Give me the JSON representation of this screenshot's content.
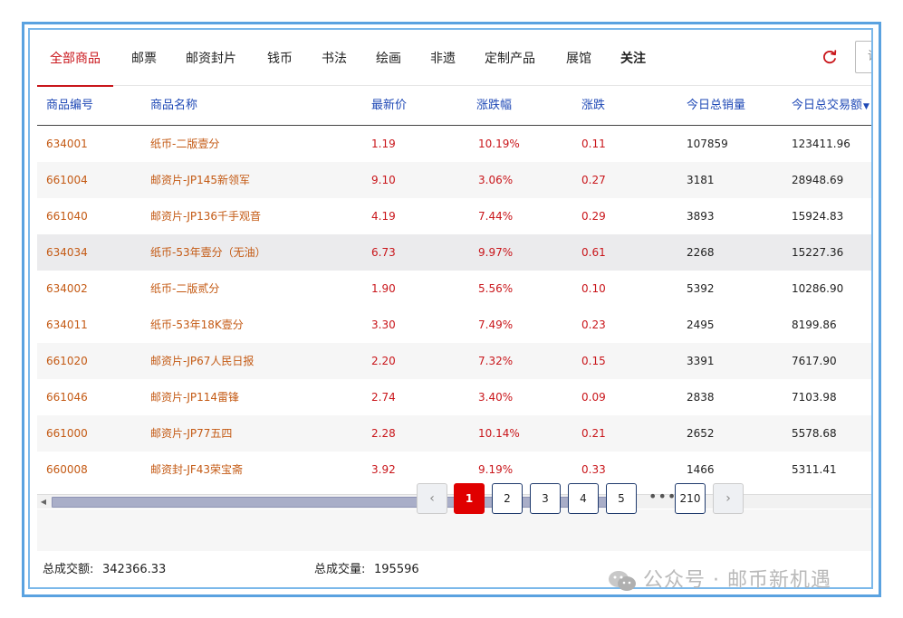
{
  "tabs": [
    {
      "label": "全部商品",
      "active": true
    },
    {
      "label": "邮票"
    },
    {
      "label": "邮资封片"
    },
    {
      "label": "钱币"
    },
    {
      "label": "书法"
    },
    {
      "label": "绘画"
    },
    {
      "label": "非遗"
    },
    {
      "label": "定制产品"
    },
    {
      "label": "展馆"
    },
    {
      "label": "关注",
      "bold": true
    }
  ],
  "search": {
    "placeholder": "请"
  },
  "table": {
    "headers": [
      "商品编号",
      "商品名称",
      "最新价",
      "涨跌幅",
      "涨跌",
      "今日总销量",
      "今日总交易额"
    ],
    "sort_indicator": "▼",
    "rows": [
      {
        "code": "634001",
        "name": "纸币-二版壹分",
        "price": "1.19",
        "pct": "10.19%",
        "change": "0.11",
        "volume": "107859",
        "amount": "123411.96"
      },
      {
        "code": "661004",
        "name": "邮资片-JP145新领军",
        "price": "9.10",
        "pct": "3.06%",
        "change": "0.27",
        "volume": "3181",
        "amount": "28948.69"
      },
      {
        "code": "661040",
        "name": "邮资片-JP136千手观音",
        "price": "4.19",
        "pct": "7.44%",
        "change": "0.29",
        "volume": "3893",
        "amount": "15924.83"
      },
      {
        "code": "634034",
        "name": "纸币-53年壹分（无油）",
        "price": "6.73",
        "pct": "9.97%",
        "change": "0.61",
        "volume": "2268",
        "amount": "15227.36"
      },
      {
        "code": "634002",
        "name": "纸币-二版贰分",
        "price": "1.90",
        "pct": "5.56%",
        "change": "0.10",
        "volume": "5392",
        "amount": "10286.90"
      },
      {
        "code": "634011",
        "name": "纸币-53年18K壹分",
        "price": "3.30",
        "pct": "7.49%",
        "change": "0.23",
        "volume": "2495",
        "amount": "8199.86"
      },
      {
        "code": "661020",
        "name": "邮资片-JP67人民日报",
        "price": "2.20",
        "pct": "7.32%",
        "change": "0.15",
        "volume": "3391",
        "amount": "7617.90"
      },
      {
        "code": "661046",
        "name": "邮资片-JP114雷锋",
        "price": "2.74",
        "pct": "3.40%",
        "change": "0.09",
        "volume": "2838",
        "amount": "7103.98"
      },
      {
        "code": "661000",
        "name": "邮资片-JP77五四",
        "price": "2.28",
        "pct": "10.14%",
        "change": "0.21",
        "volume": "2652",
        "amount": "5578.68"
      },
      {
        "code": "660008",
        "name": "邮资封-JF43荣宝斋",
        "price": "3.92",
        "pct": "9.19%",
        "change": "0.33",
        "volume": "1466",
        "amount": "5311.41"
      }
    ]
  },
  "pagination": {
    "prev": "‹",
    "pages": [
      "1",
      "2",
      "3",
      "4",
      "5"
    ],
    "ellipsis": "•••",
    "last": "210",
    "next": "›",
    "current": "1"
  },
  "footer": {
    "total_amount_label": "总成交额:",
    "total_amount": "342366.33",
    "total_volume_label": "总成交量:",
    "total_volume": "195596"
  },
  "watermark": {
    "text": "公众号 · 邮币新机遇"
  },
  "colors": {
    "accent": "#c9161b",
    "header_text": "#1f49b6",
    "frame": "#5aa2e0",
    "page_active": "#e00000"
  }
}
